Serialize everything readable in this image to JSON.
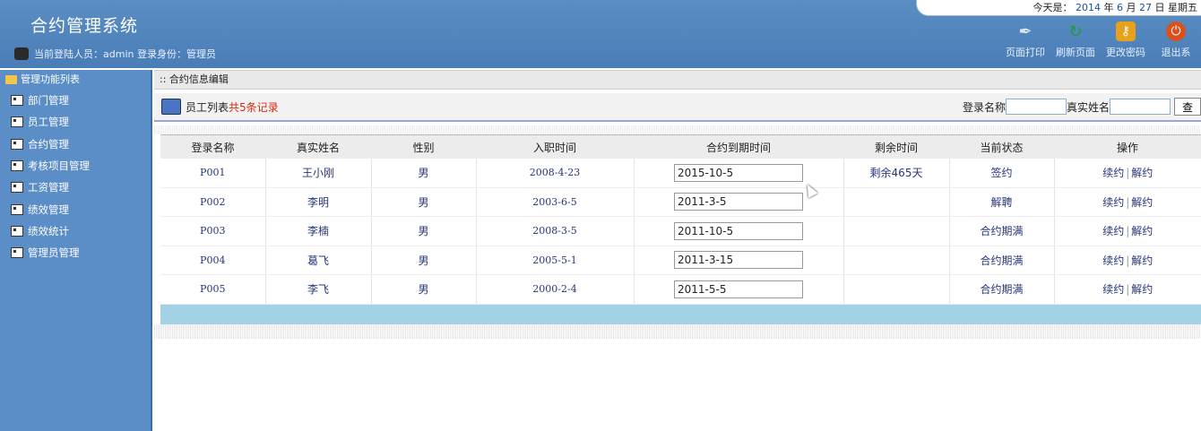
{
  "header": {
    "title": "合约管理系统",
    "user_line": "当前登陆人员：admin 登录身份：管理员",
    "date_label": "今天是：",
    "date_year": "2014",
    "date_year_unit": "年",
    "date_month": "6",
    "date_month_unit": "月",
    "date_day": "27",
    "date_day_unit": "日",
    "weekday": "星期五",
    "tools": [
      {
        "label": "页面打印",
        "icon": "print-icon"
      },
      {
        "label": "刷新页面",
        "icon": "refresh-icon"
      },
      {
        "label": "更改密码",
        "icon": "key-icon"
      },
      {
        "label": "退出系",
        "icon": "power-icon"
      }
    ]
  },
  "sidebar": {
    "heading": "管理功能列表",
    "items": [
      {
        "label": "部门管理"
      },
      {
        "label": "员工管理"
      },
      {
        "label": "合约管理"
      },
      {
        "label": "考核项目管理"
      },
      {
        "label": "工资管理"
      },
      {
        "label": "绩效管理"
      },
      {
        "label": "绩效统计"
      },
      {
        "label": "管理员管理"
      }
    ]
  },
  "main": {
    "breadcrumb": ":: 合约信息编辑",
    "list_title": "员工列表",
    "record_count": "共5条记录",
    "search": {
      "login_label": "登录名称",
      "name_label": "真实姓名",
      "button_label": "查"
    },
    "table": {
      "columns": [
        "登录名称",
        "真实姓名",
        "性别",
        "入职时间",
        "合约到期时间",
        "剩余时间",
        "当前状态",
        "操作"
      ],
      "rows": [
        {
          "login": "P001",
          "name": "王小刚",
          "gender": "男",
          "hire": "2008-4-23",
          "expire": "2015-10-5",
          "remain": "剩余465天",
          "status": "签约"
        },
        {
          "login": "P002",
          "name": "李明",
          "gender": "男",
          "hire": "2003-6-5",
          "expire": "2011-3-5",
          "remain": "",
          "status": "解聘"
        },
        {
          "login": "P003",
          "name": "李楠",
          "gender": "男",
          "hire": "2008-3-5",
          "expire": "2011-10-5",
          "remain": "",
          "status": "合约期满"
        },
        {
          "login": "P004",
          "name": "葛飞",
          "gender": "男",
          "hire": "2005-5-1",
          "expire": "2011-3-15",
          "remain": "",
          "status": "合约期满"
        },
        {
          "login": "P005",
          "name": "李飞",
          "gender": "男",
          "hire": "2000-2-4",
          "expire": "2011-5-5",
          "remain": "",
          "status": "合约期满"
        }
      ],
      "op_renew": "续约",
      "op_sep": "|",
      "op_cancel": "解约"
    }
  }
}
